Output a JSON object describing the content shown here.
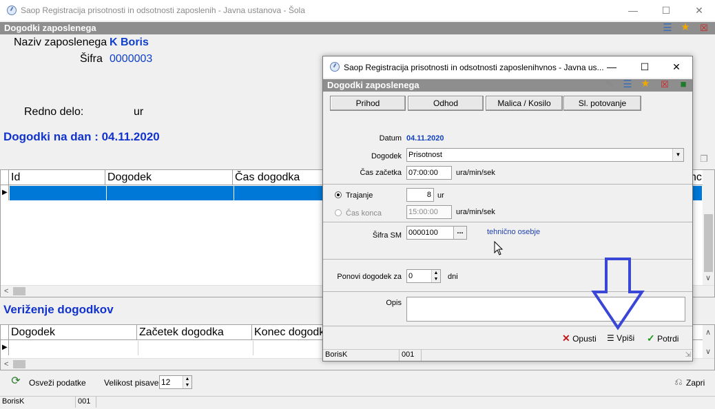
{
  "main": {
    "title": "Saop Registracija prisotnosti in odsotnosti zaposlenih - Javna ustanova - Šola",
    "section_title": "Dogodki zaposlenega",
    "employee_name_label": "Naziv zaposlenega",
    "employee_name": "K Boris",
    "code_label": "Šifra",
    "code": "0000003",
    "regular_work_label": "Redno delo:",
    "regular_work_unit": "ur",
    "events_heading": "Dogodki na dan : 04.11.2020",
    "events_grid": {
      "columns": [
        "Id",
        "Dogodek",
        "Čas dogodka"
      ],
      "right_fragment": "nc"
    },
    "chaining_heading": "Veriženje dogodkov",
    "chain_grid": {
      "columns": [
        "Dogodek",
        "Začetek dogodka",
        "Konec dogodk"
      ]
    },
    "refresh_label": "Osveži podatke",
    "font_size_label": "Velikost pisave:",
    "font_size_value": "12",
    "close_label": "Zapri",
    "status": {
      "user": "BorisK",
      "code": "001"
    }
  },
  "dialog": {
    "title": "Saop Registracija prisotnosti in odsotnosti zaposlenihvnos - Javna us...",
    "section_title": "Dogodki zaposlenega",
    "buttons": [
      "Prihod",
      "Odhod",
      "Malica / Kosilo",
      "Sl. potovanje"
    ],
    "date_label": "Datum",
    "date_value": "04.11.2020",
    "event_label": "Dogodek",
    "event_value": "Prisotnost",
    "start_label": "Čas začetka",
    "start_value": "07:00:00",
    "time_unit": "ura/min/sek",
    "duration_label": "Trajanje",
    "duration_value": "8",
    "duration_unit": "ur",
    "end_label": "Čas konca",
    "end_value": "15:00:00",
    "sm_label": "Šifra SM",
    "sm_value": "0000100",
    "sm_desc": "tehnično osebje",
    "repeat_label": "Ponovi dogodek  za",
    "repeat_value": "0",
    "repeat_unit": "dni",
    "desc_label": "Opis",
    "cancel_label": "Opusti",
    "enter_label": "Vpiši",
    "confirm_label": "Potrdi",
    "status": {
      "user": "BorisK",
      "code": "001"
    }
  },
  "icons": [
    "stopwatch-icon",
    "list-icon",
    "star-icon",
    "delete-icon",
    "edit-icon",
    "book-icon",
    "refresh-icon",
    "close-door-icon",
    "arrow-down-icon",
    "mouse-cursor-icon"
  ],
  "colors": {
    "accent_blue": "#0f3fc9",
    "selection": "#0078d7",
    "section_bar": "#8e8e8e",
    "annotation_arrow": "#3a46d6"
  }
}
